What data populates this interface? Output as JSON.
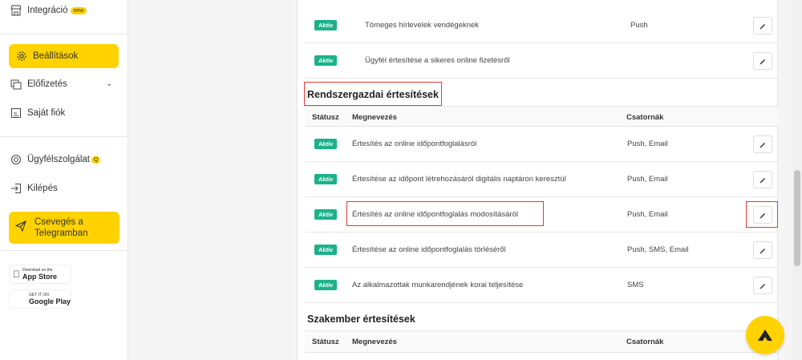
{
  "sidebar": {
    "integration": {
      "label": "Integráció",
      "badge": "new"
    },
    "settings": {
      "label": "Beállítások"
    },
    "subscription": {
      "label": "Előfizetés"
    },
    "account": {
      "label": "Saját fiók"
    },
    "support": {
      "label": "Ügyfélszolgálat",
      "badge": "Q"
    },
    "logout": {
      "label": "Kilépés"
    },
    "telegram": {
      "line1": "Csevegés a",
      "line2": "Telegramban"
    },
    "appstore": {
      "small": "Download on the",
      "big": "App Store"
    },
    "googleplay": {
      "small": "GET IT ON",
      "big": "Google Play"
    }
  },
  "top_rows": [
    {
      "status": "Aktív",
      "name": "Tömeges hírlevelek vendégeknek",
      "channels": "Push"
    },
    {
      "status": "Aktív",
      "name": "Ügyfél értesítése a sikeres online fizetésről",
      "channels": ""
    }
  ],
  "admin_section": {
    "title": "Rendszergazdai értesítések",
    "headers": {
      "status": "Státusz",
      "name": "Megnevezés",
      "channels": "Csatornák"
    },
    "rows": [
      {
        "status": "Aktív",
        "name": "Értesítés az online időpontfoglalásról",
        "channels": "Push, Email"
      },
      {
        "status": "Aktív",
        "name": "Értesítése az időpont létrehozásáról digitális naptáron keresztül",
        "channels": "Push, Email"
      },
      {
        "status": "Aktív",
        "name": "Értesítés az online időpontfoglalás modosításáról",
        "channels": "Push, Email"
      },
      {
        "status": "Aktív",
        "name": "Értesítése az online időpontfoglalás törléséről",
        "channels": "Push, SMS, Email"
      },
      {
        "status": "Aktív",
        "name": "Az alkalmazottak munkarendjének korai teljesítése",
        "channels": "SMS"
      }
    ]
  },
  "specialist_section": {
    "title": "Szakember értesítések",
    "headers": {
      "status": "Státusz",
      "name": "Megnevezés",
      "channels": "Csatornák"
    }
  },
  "colors": {
    "accent": "#ffd200",
    "active_badge": "#1bb28a",
    "highlight": "#e53935"
  }
}
